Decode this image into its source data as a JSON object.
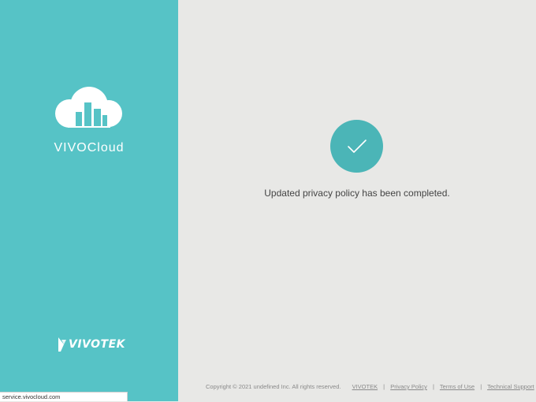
{
  "sidebar": {
    "app_name": "VIVOCloud",
    "brand_logo_text": "VIVOTEK",
    "icon": "cloud-building-icon"
  },
  "main": {
    "status_icon": "checkmark-icon",
    "message": "Updated privacy policy has been completed."
  },
  "footer": {
    "copyright": "Copyright © 2021 undefined Inc. All rights reserved.",
    "links": [
      "VIVOTEK",
      "Privacy Policy",
      "Terms of Use",
      "Technical Support"
    ],
    "separator": "|"
  },
  "status_bar": {
    "url": "service.vivocloud.com"
  },
  "colors": {
    "sidebar_bg": "#56c3c6",
    "main_bg": "#e8e8e6",
    "accent": "#4bb5b7"
  }
}
